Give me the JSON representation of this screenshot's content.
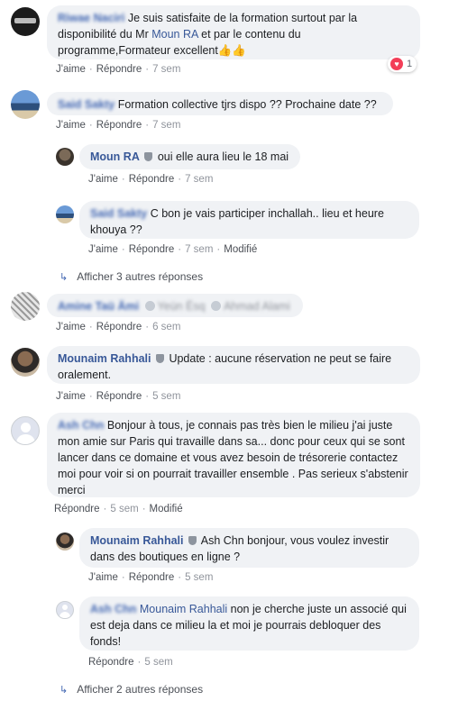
{
  "comments": [
    {
      "author": "Riwae Naciri",
      "text": "Je suis satisfaite de la formation surtout par la disponibilité du Mr ",
      "mention": "Moun RA",
      "text_after": " et par le contenu du programme,Formateur excellent",
      "emoji": "👍👍",
      "actions": {
        "like": "J'aime",
        "reply": "Répondre",
        "time": "7 sem"
      },
      "reactions": {
        "icon": "heart-icon",
        "count": "1"
      }
    },
    {
      "author": "Said Sakty",
      "text": "Formation collective tjrs dispo ?? Prochaine date ??",
      "actions": {
        "like": "J'aime",
        "reply": "Répondre",
        "time": "7 sem"
      },
      "replies": [
        {
          "author": "Moun RA",
          "text": "oui elle aura lieu le 18 mai",
          "actions": {
            "like": "J'aime",
            "reply": "Répondre",
            "time": "7 sem"
          }
        },
        {
          "author": "Said Sakty",
          "text": "C bon je vais participer inchallah.. lieu et heure khouya ??",
          "actions": {
            "like": "J'aime",
            "reply": "Répondre",
            "time": "7 sem",
            "edited": "Modifié"
          }
        }
      ],
      "more_replies": "Afficher 3 autres réponses"
    },
    {
      "author": "Amine Taü Ämi",
      "tag1": "Yeün Ësq",
      "tag2": "Ahmad Alami",
      "actions": {
        "like": "J'aime",
        "reply": "Répondre",
        "time": "6 sem"
      }
    },
    {
      "author": "Mounaim Rahhali",
      "text": "Update : aucune réservation ne peut se faire oralement.",
      "actions": {
        "like": "J'aime",
        "reply": "Répondre",
        "time": "5 sem"
      }
    },
    {
      "author": "Ash Chn",
      "text": "Bonjour à tous, je connais pas très bien le milieu j'ai juste mon amie sur Paris qui travaille dans sa... donc pour ceux qui se sont lancer dans ce domaine et vous avez besoin de trésorerie contactez moi pour voir si on pourrait travailler ensemble . Pas serieux s'abstenir merci",
      "actions": {
        "reply": "Répondre",
        "time": "5 sem",
        "edited": "Modifié"
      },
      "replies": [
        {
          "author": "Mounaim Rahhali",
          "text": "Ash Chn bonjour, vous voulez investir dans des boutiques en ligne ?",
          "actions": {
            "like": "J'aime",
            "reply": "Répondre",
            "time": "5 sem"
          }
        },
        {
          "author": "Ash Chn",
          "mention": "Mounaim Rahhali",
          "text": "non je cherche juste un associé qui est deja dans ce milieu la et moi je pourrais debloquer des fonds!",
          "actions": {
            "reply": "Répondre",
            "time": "5 sem"
          }
        }
      ],
      "more_replies": "Afficher 2 autres réponses"
    }
  ],
  "colors": {
    "link": "#385898",
    "bubble": "#f0f2f5",
    "muted": "#90949c",
    "heart": "#f33e58"
  }
}
